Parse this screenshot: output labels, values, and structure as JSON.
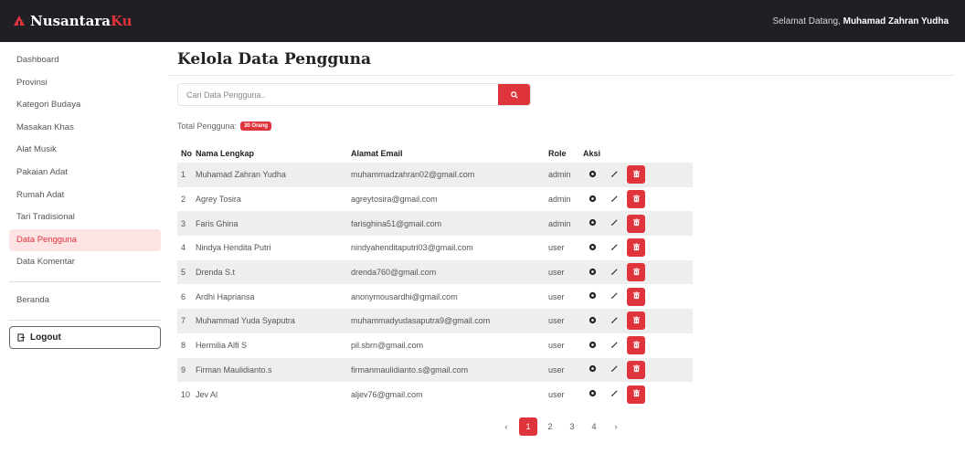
{
  "header": {
    "brand_main": "Nusantara",
    "brand_accent": "Ku",
    "welcome_prefix": "Selamat Datang,",
    "user_name": "Muhamad Zahran Yudha"
  },
  "sidebar": {
    "items": [
      {
        "label": "Dashboard"
      },
      {
        "label": "Provinsi"
      },
      {
        "label": "Kategori Budaya"
      },
      {
        "label": "Masakan Khas"
      },
      {
        "label": "Alat Musik"
      },
      {
        "label": "Pakaian Adat"
      },
      {
        "label": "Rumah Adat"
      },
      {
        "label": "Tari Tradisional"
      },
      {
        "label": "Data Pengguna",
        "active": true
      },
      {
        "label": "Data Komentar"
      }
    ],
    "beranda": "Beranda",
    "logout": "Logout"
  },
  "main": {
    "title": "Kelola Data Pengguna",
    "search_placeholder": "Cari Data Pengguna..",
    "total_label": "Total Pengguna:",
    "total_badge": "30 Orang",
    "columns": [
      "No",
      "Nama Lengkap",
      "Alamat Email",
      "Role",
      "Aksi"
    ],
    "rows": [
      [
        "1",
        "Muhamad Zahran Yudha",
        "muhammadzahran02@gmail.com",
        "admin"
      ],
      [
        "2",
        "Agrey Tosira",
        "agreytosira@gmail.com",
        "admin"
      ],
      [
        "3",
        "Faris Ghina",
        "farisghina51@gmail.com",
        "admin"
      ],
      [
        "4",
        "Nindya Hendita Putri",
        "nindyahenditaputri03@gmail.com",
        "user"
      ],
      [
        "5",
        "Drenda S.t",
        "drenda760@gmail.com",
        "user"
      ],
      [
        "6",
        "Ardhi Hapriansa",
        "anonymousardhi@gmail.com",
        "user"
      ],
      [
        "7",
        "Muhammad Yuda Syaputra",
        "muhammadyudasaputra9@gmail.com",
        "user"
      ],
      [
        "8",
        "Hermilia Alfi S",
        "pil.sbrn@gmail.com",
        "user"
      ],
      [
        "9",
        "Firman Maulidianto.s",
        "firmanmaulidianto.s@gmail.com",
        "user"
      ],
      [
        "10",
        "Jev Al",
        "aljev76@gmail.com",
        "user"
      ]
    ]
  },
  "pagination": {
    "prev": "‹",
    "pages": [
      "1",
      "2",
      "3",
      "4"
    ],
    "next": "›"
  },
  "colors": {
    "accent": "#e0343c",
    "topbar": "#1f1f24",
    "active_bg": "#fde3e4"
  },
  "icons": {
    "brand": "temple-icon",
    "search": "search-icon",
    "logout": "logout-icon",
    "view": "eye-icon",
    "edit": "pencil-icon",
    "delete": "trash-icon"
  }
}
